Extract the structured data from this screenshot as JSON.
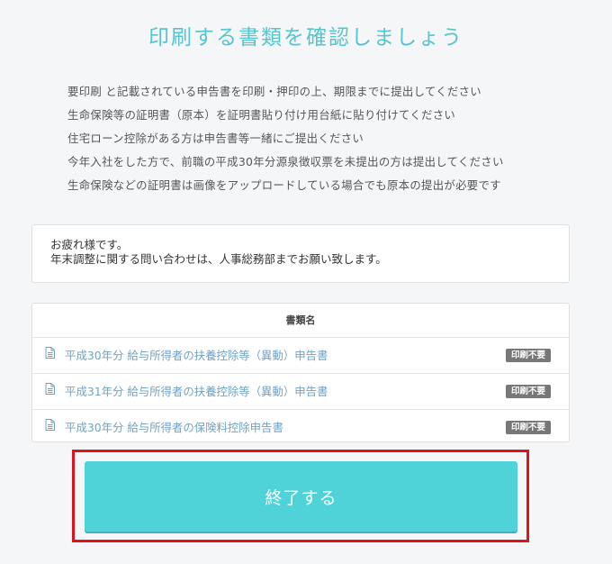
{
  "page": {
    "title": "印刷する書類を確認しましょう"
  },
  "instructions": [
    "要印刷 と記載されている申告書を印刷・押印の上、期限までに提出してください",
    "生命保険等の証明書（原本）を証明書貼り付け用台紙に貼り付けてください",
    "住宅ローン控除がある方は申告書等一緒にご提出ください",
    "今年入社をした方で、前職の平成30年分源泉徴収票を未提出の方は提出してください",
    "生命保険などの証明書は画像をアップロードしている場合でも原本の提出が必要です"
  ],
  "message": {
    "line1": "お疲れ様です。",
    "line2": "年末調整に関する問い合わせは、人事総務部までお願い致します。"
  },
  "documents": {
    "header": "書類名",
    "rows": [
      {
        "name": "平成30年分 給与所得者の扶養控除等（異動）申告書",
        "badge": "印刷不要"
      },
      {
        "name": "平成31年分 給与所得者の扶養控除等（異動）申告書",
        "badge": "印刷不要"
      },
      {
        "name": "平成30年分 給与所得者の保険料控除申告書",
        "badge": "印刷不要"
      }
    ]
  },
  "actions": {
    "finish_label": "終了する"
  },
  "colors": {
    "accent": "#50d2d9",
    "title": "#55c5cf",
    "link": "#6fa3c4",
    "badge": "#777777",
    "highlight": "#e0121a"
  },
  "icons": {
    "document": "document-icon"
  }
}
